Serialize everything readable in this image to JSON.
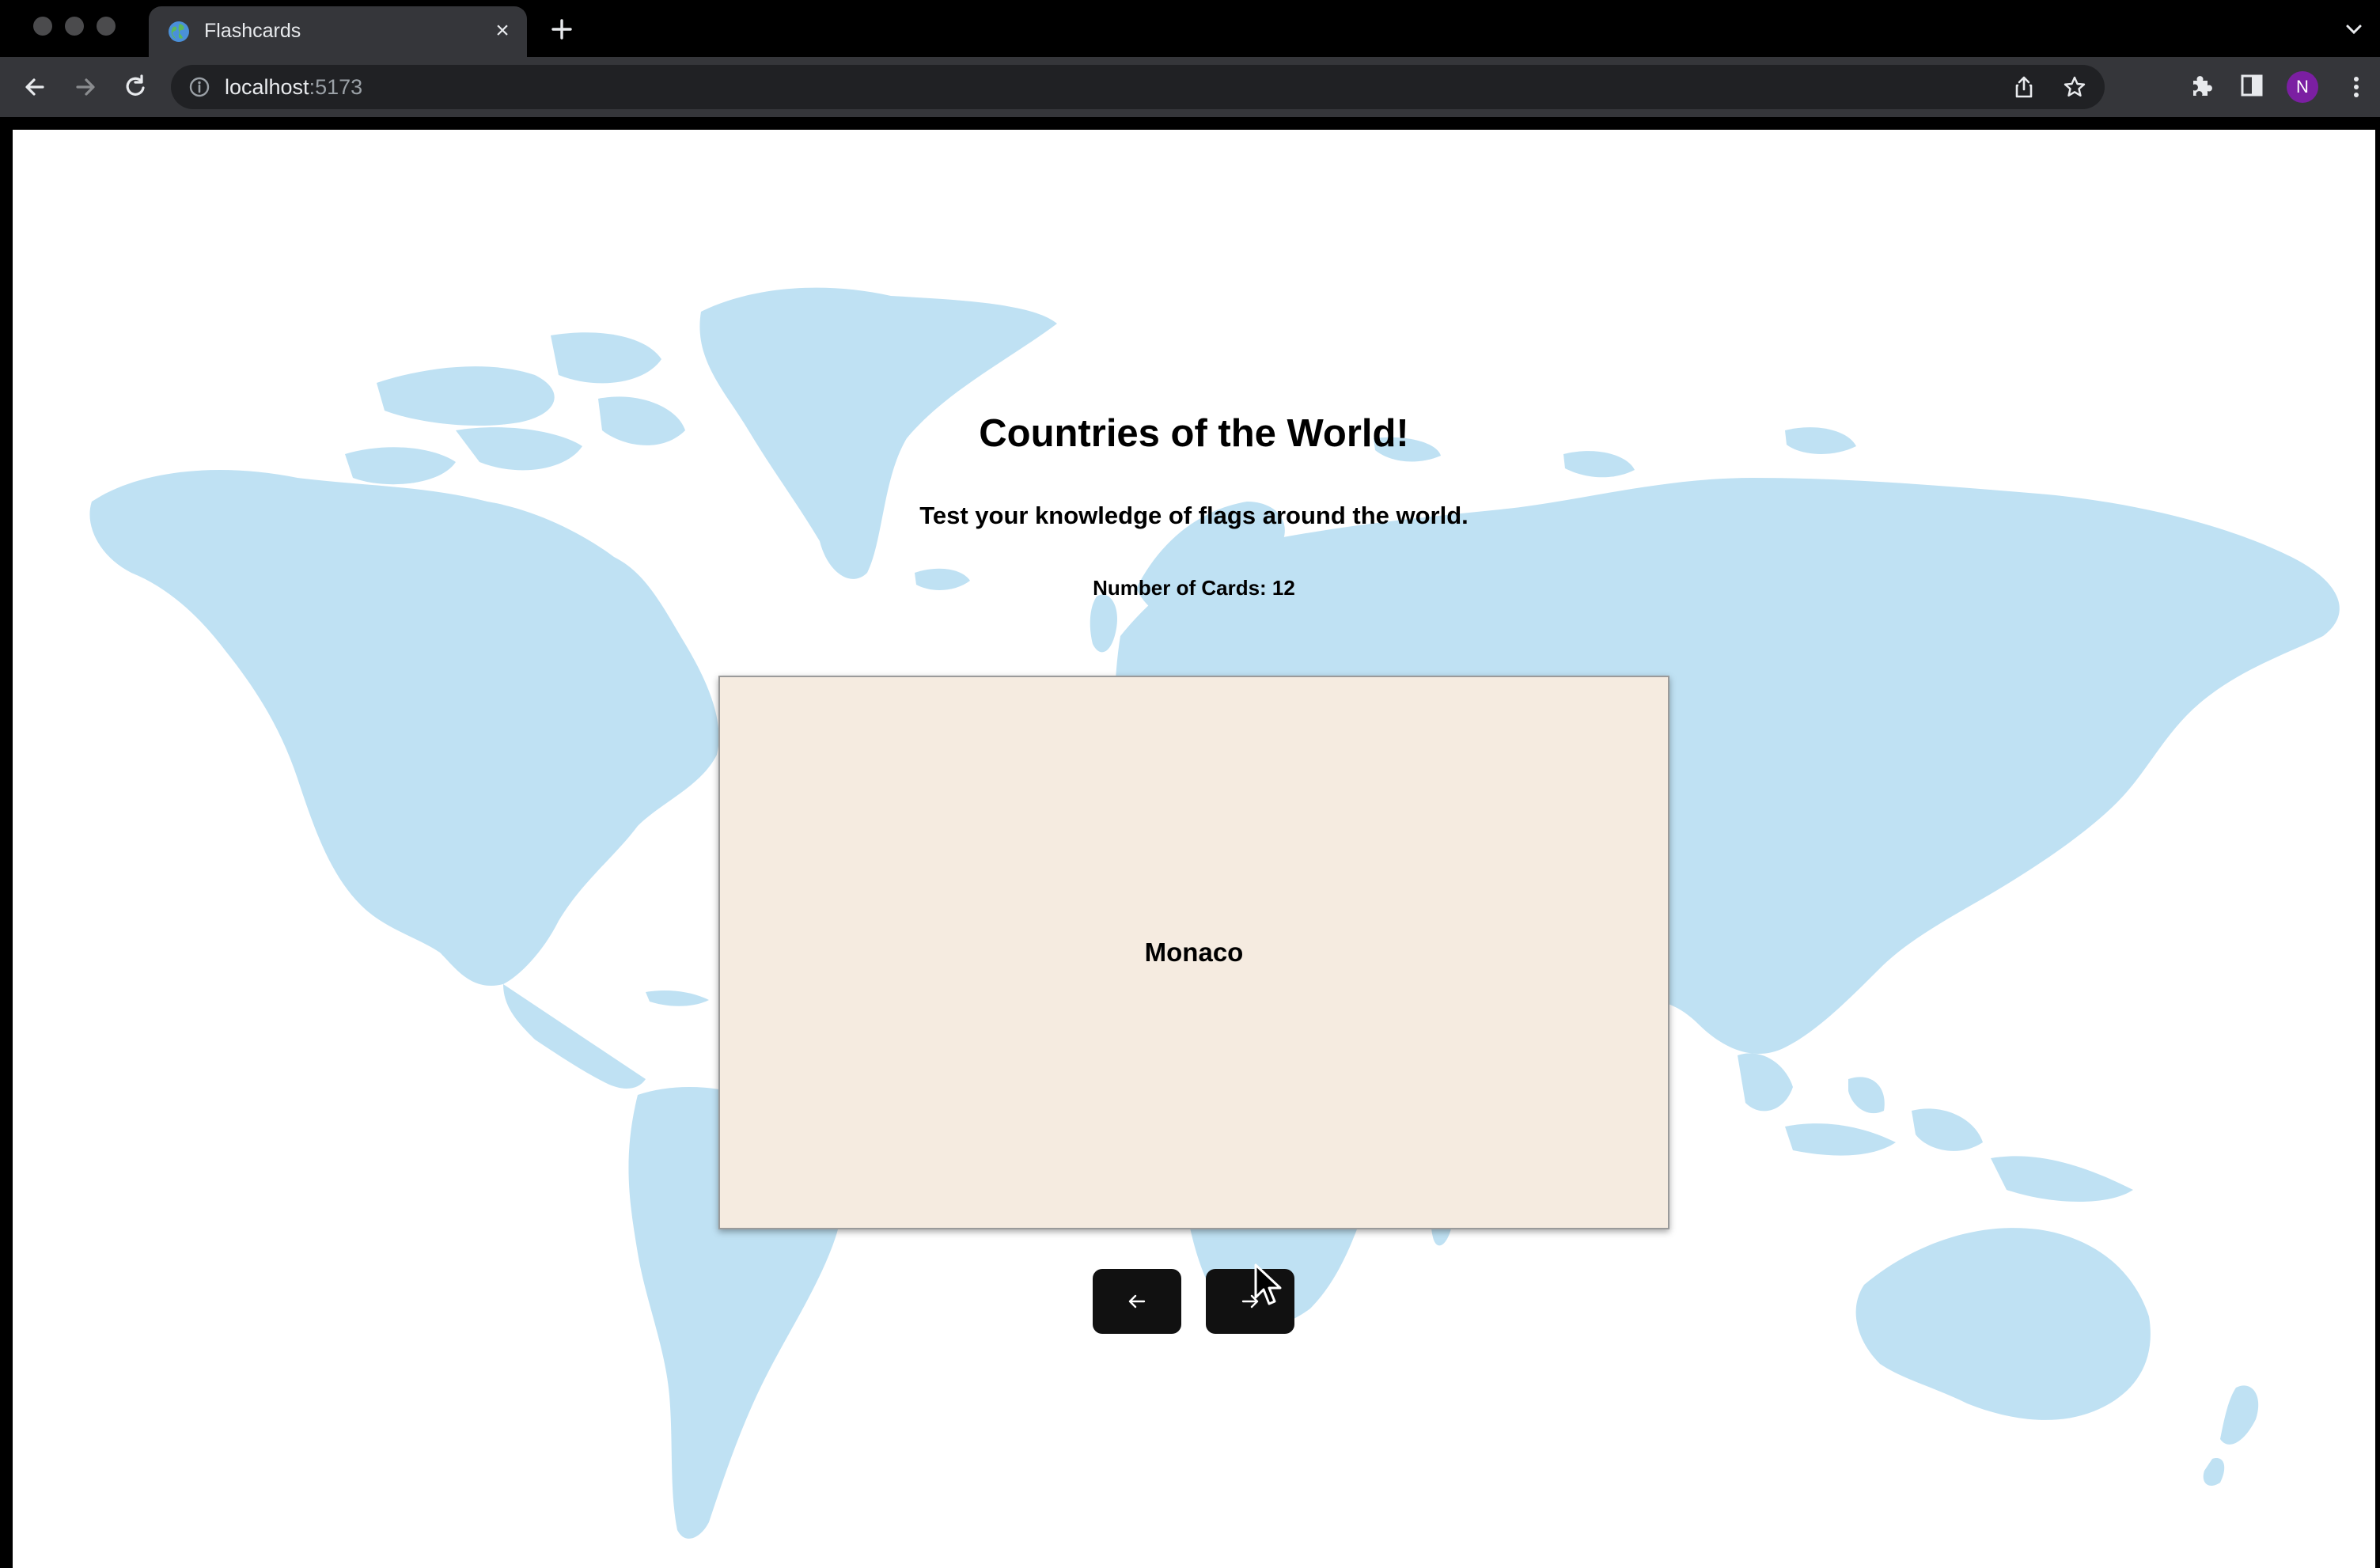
{
  "browser": {
    "tab": {
      "title": "Flashcards",
      "favicon": "globe-icon"
    },
    "url": {
      "host": "localhost",
      "port": ":5173"
    },
    "profile_initial": "N"
  },
  "page": {
    "title": "Countries of the World!",
    "subtitle": "Test your knowledge of flags around the world.",
    "card_count_label": "Number of Cards: 12",
    "card": {
      "text": "Monaco"
    },
    "buttons": {
      "prev_icon": "arrow-left-icon",
      "next_icon": "arrow-right-icon"
    }
  },
  "colors": {
    "map": "#bfe1f3",
    "card_bg": "#f5ebe0",
    "button_bg": "#111111",
    "chrome_dark": "#000000",
    "chrome_toolbar": "#35363a",
    "profile": "#7b1fa2"
  }
}
